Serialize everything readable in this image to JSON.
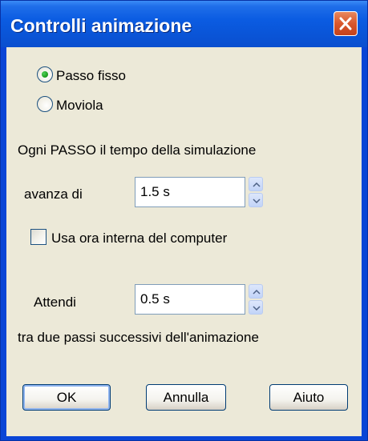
{
  "window": {
    "title": "Controlli animazione"
  },
  "mode": {
    "options": [
      {
        "label": "Passo fisso",
        "selected": true
      },
      {
        "label": "Moviola",
        "selected": false
      }
    ]
  },
  "step": {
    "description": "Ogni PASSO il tempo della simulazione",
    "advance_label": "avanza di",
    "advance_value": "1.5 s",
    "use_internal_clock_label": "Usa ora interna del computer",
    "use_internal_clock_checked": false
  },
  "wait": {
    "label": "Attendi",
    "value": "0.5 s",
    "description": "tra due passi successivi dell'animazione"
  },
  "buttons": {
    "ok": "OK",
    "cancel": "Annulla",
    "help": "Aiuto"
  },
  "colors": {
    "title_bar": "#0a55d8",
    "dialog_background": "#ece9d8",
    "close_button": "#d9572c",
    "radio_selected": "#21a121"
  },
  "icons": {
    "close": "close-icon",
    "spin_up": "spin-up-icon",
    "spin_down": "spin-down-icon"
  }
}
